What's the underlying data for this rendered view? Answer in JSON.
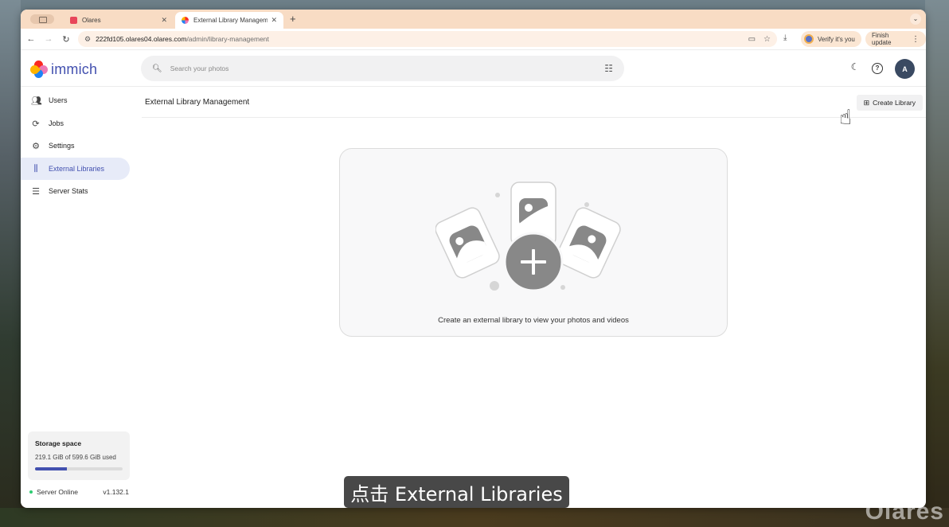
{
  "browser": {
    "tabs": [
      {
        "title": "Olares",
        "active": false
      },
      {
        "title": "External Library Management",
        "active": true
      }
    ],
    "url_host": "222fd105.olares04.olares.com",
    "url_path": "/admin/library-management",
    "verify_label": "Verify it's you",
    "finish_update_label": "Finish update"
  },
  "app": {
    "name": "immich",
    "search_placeholder": "Search your photos"
  },
  "sidebar": {
    "items": [
      {
        "label": "Users",
        "icon": "users-icon",
        "active": false
      },
      {
        "label": "Jobs",
        "icon": "sync-icon",
        "active": false
      },
      {
        "label": "Settings",
        "icon": "gear-icon",
        "active": false
      },
      {
        "label": "External Libraries",
        "icon": "library-icon",
        "active": true
      },
      {
        "label": "Server Stats",
        "icon": "server-icon",
        "active": false
      }
    ],
    "storage": {
      "title": "Storage space",
      "used_text": "219.1 GiB of 599.6 GiB used",
      "used_fraction": 0.365
    },
    "server_status": "Server Online",
    "version": "v1.132.1"
  },
  "header": {
    "avatar_initial": "A"
  },
  "page": {
    "title": "External Library Management",
    "create_button": "Create Library",
    "empty_message": "Create an external library to view your photos and videos"
  },
  "overlay": {
    "subtitle": "点击 External Libraries",
    "watermark": "Olares"
  },
  "colors": {
    "accent": "#4250af",
    "tabbar": "#f8dcc4",
    "status_online": "#2ecc71"
  }
}
